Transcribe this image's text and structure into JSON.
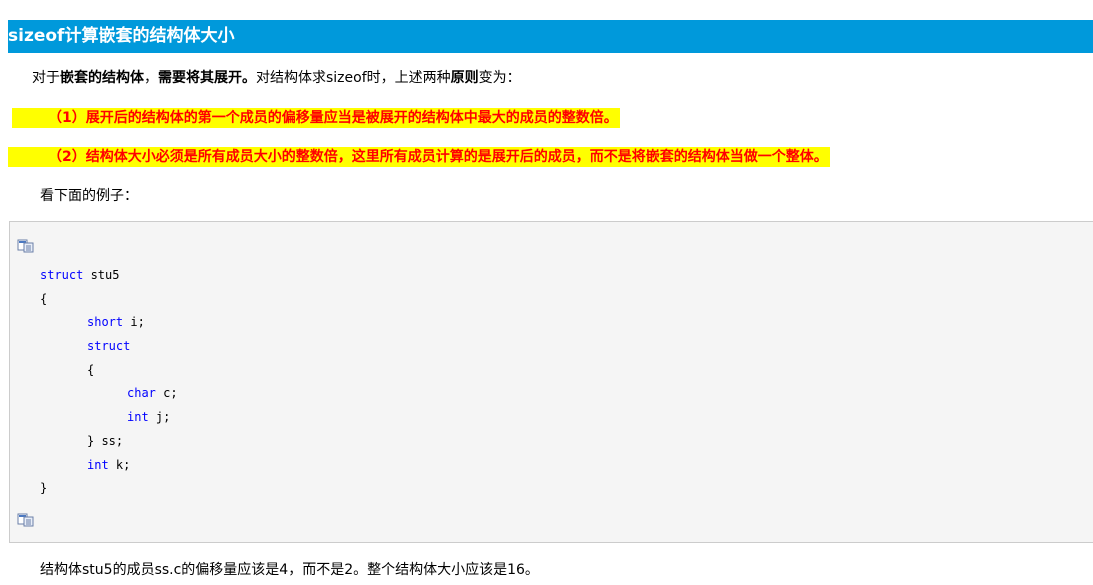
{
  "heading": "sizeof计算嵌套的结构体大小",
  "intro": {
    "p1": "对于",
    "b1": "嵌套的结构体",
    "p2": "，",
    "b2": "需要将其展开。",
    "p3": "对结构体求sizeof时，上述两种",
    "b3": "原则",
    "p4": "变为："
  },
  "rules": [
    "（1）展开后的结构体的第一个成员的偏移量应当是被展开的结构体中最大的成员的整数倍。",
    "（2）结构体大小必须是所有成员大小的整数倍，这里所有成员计算的是展开后的成员，而不是将嵌套的结构体当做一个整体。"
  ],
  "look_below": "看下面的例子：",
  "code": {
    "l1_kw": "struct",
    "l1_rest": " stu5",
    "l2": "{",
    "l3_kw": "short",
    "l3_rest": " i;",
    "l4_kw": "struct",
    "l5": "{",
    "l6_kw": "char",
    "l6_rest": " c;",
    "l7_kw": "int",
    "l7_rest": " j;",
    "l8": "} ss;",
    "l9_kw": "int",
    "l9_rest": " k;",
    "l10": "}"
  },
  "conclusion": "结构体stu5的成员ss.c的偏移量应该是4，而不是2。整个结构体大小应该是16。",
  "colors": {
    "heading_bg": "#0099db",
    "highlight_bg": "#ffff00",
    "highlight_text": "#ff0000",
    "keyword": "#0000ff"
  },
  "icons": [
    "copy-code-icon",
    "copy-code-icon"
  ]
}
